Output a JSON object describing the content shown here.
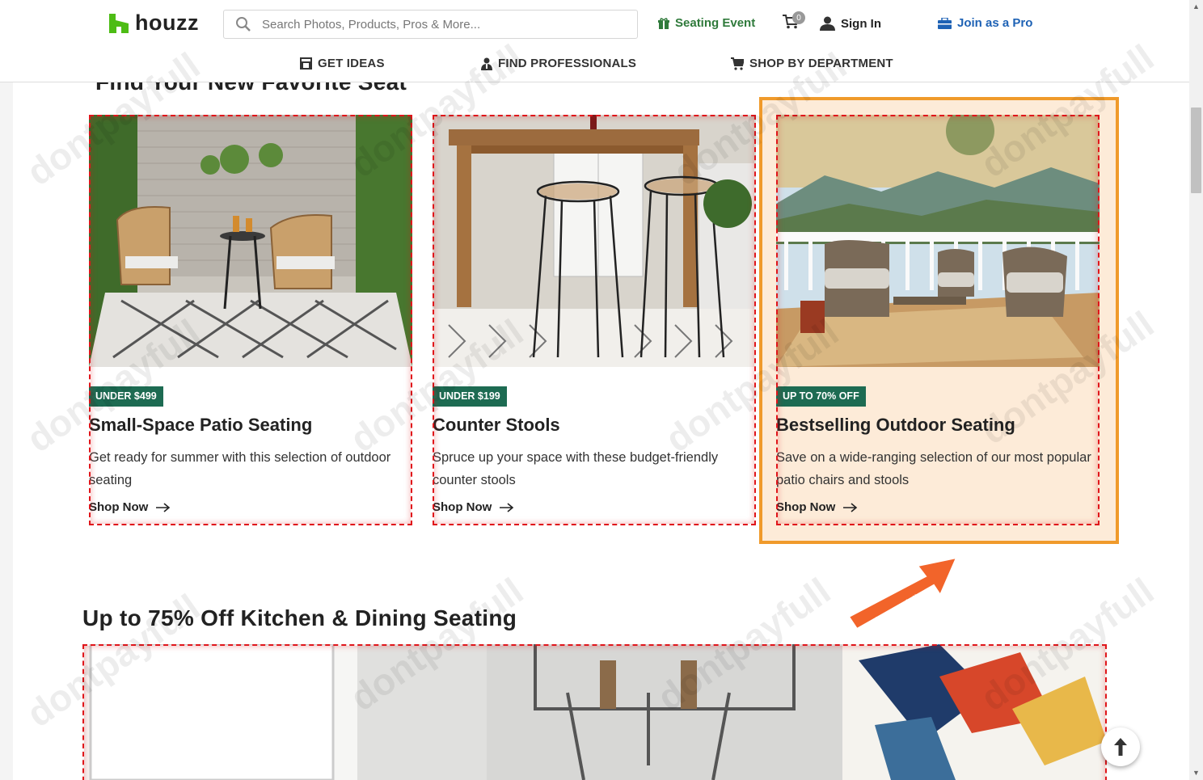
{
  "header": {
    "logo_text": "houzz",
    "search_placeholder": "Search Photos, Products, Pros & More...",
    "seating_event": "Seating Event",
    "cart_count": "0",
    "sign_in": "Sign In",
    "join_pro": "Join as a Pro"
  },
  "nav": {
    "get_ideas": "GET IDEAS",
    "find_pros": "FIND PROFESSIONALS",
    "shop_dept": "SHOP BY DEPARTMENT"
  },
  "section1": {
    "title": "Find Your New Favorite Seat"
  },
  "cards": [
    {
      "badge": "UNDER $499",
      "title": "Small-Space Patio Seating",
      "desc": "Get ready for summer with this selection of outdoor seating",
      "cta": "Shop Now"
    },
    {
      "badge": "UNDER $199",
      "title": "Counter Stools",
      "desc": "Spruce up your space with these budget-friendly counter stools",
      "cta": "Shop Now"
    },
    {
      "badge": "UP TO 70% OFF",
      "title": "Bestselling Outdoor Seating",
      "desc": "Save on a wide-ranging selection of our most popular patio chairs and stools",
      "cta": "Shop Now"
    }
  ],
  "section2": {
    "title": "Up to 75% Off Kitchen & Dining Seating"
  },
  "watermark": "dontpayfull",
  "colors": {
    "brand_green": "#4dbc15",
    "badge_green": "#1d6b52",
    "seating_event": "#2f7a3b",
    "join_pro": "#1e62b5",
    "highlight": "#f09a2b",
    "outline_red": "#e0161b"
  }
}
